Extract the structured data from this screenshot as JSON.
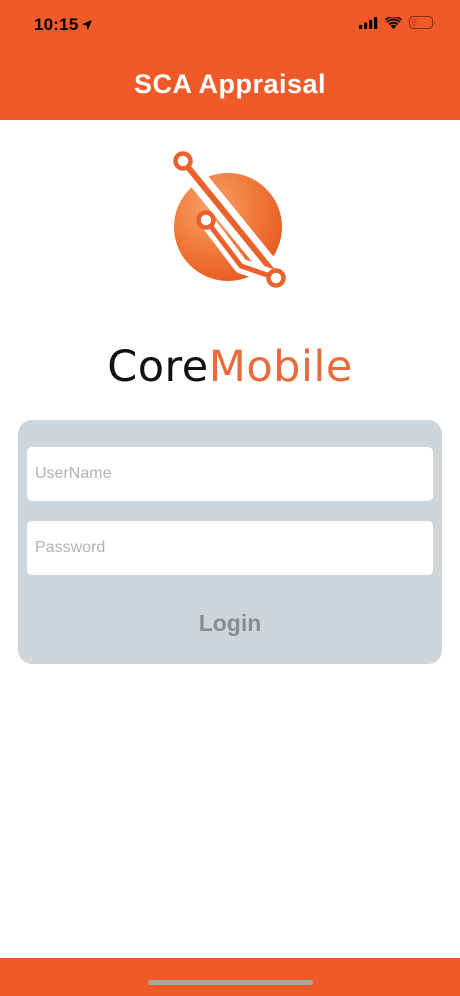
{
  "status_bar": {
    "time": "10:15",
    "icons": [
      "location-arrow-icon",
      "cellular-signal-icon",
      "wifi-icon",
      "battery-low-icon"
    ]
  },
  "nav": {
    "title": "SCA Appraisal"
  },
  "brand": {
    "part1": "Core",
    "part2": "Mobile",
    "accent_color": "#E96A3A"
  },
  "login": {
    "username_placeholder": "UserName",
    "username_value": "",
    "password_placeholder": "Password",
    "password_value": "",
    "button_label": "Login"
  },
  "colors": {
    "primary": "#F05A28",
    "panel": "#CED5DB",
    "button_text": "#8A8D90",
    "battery_low": "#E8432D"
  }
}
